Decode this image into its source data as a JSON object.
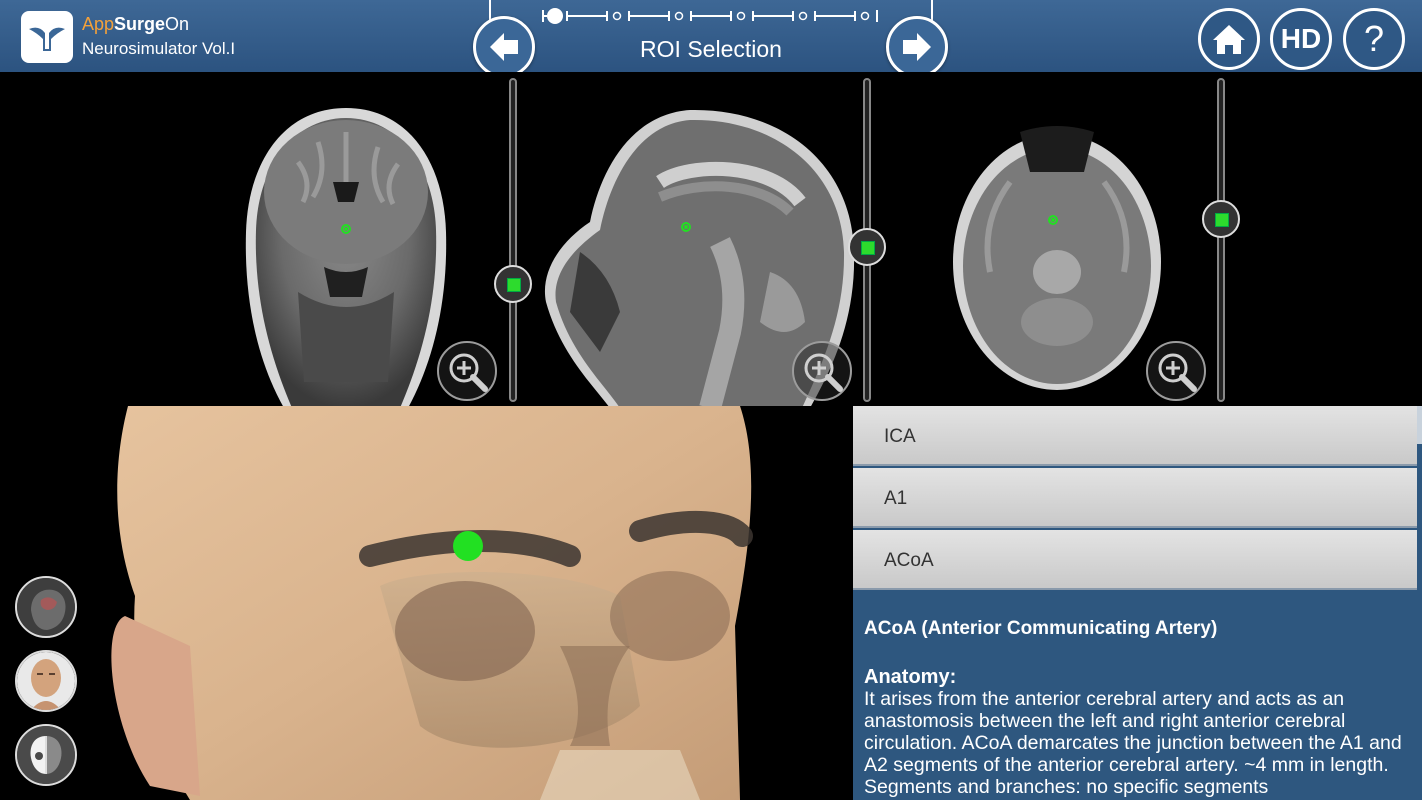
{
  "header": {
    "brand": {
      "app": "App",
      "surge": "Surge",
      "on": "On"
    },
    "subtitle": "Neurosimulator Vol.I",
    "step_title": "ROI Selection",
    "hd_label": "HD",
    "help_label": "?",
    "stepper_total": 6,
    "stepper_active": 1
  },
  "icons": {
    "app": "app-logo-icon",
    "prev": "left-arrow-icon",
    "next": "right-arrow-icon",
    "home": "home-icon",
    "zoom": "zoom-in-icon"
  },
  "mri": {
    "views": [
      "coronal",
      "sagittal",
      "axial"
    ],
    "slider_levels": [
      0.62,
      0.52,
      0.43
    ]
  },
  "list": {
    "items": [
      "ICA",
      "A1",
      "ACoA"
    ]
  },
  "info": {
    "title": "ACoA (Anterior Communicating Artery)",
    "section_heading": "Anatomy:",
    "body": "It arises from the anterior cerebral artery and acts as an anastomosis between the left and right anterior cerebral circulation. ACoA demarcates the junction between the A1 and A2 segments of the anterior cerebral artery. ~4 mm in length. Segments and branches: no specific segments"
  },
  "colors": {
    "header_bg": "#34608d",
    "panel_bg": "#2e577f",
    "marker_green": "#22e022",
    "brand_orange": "#f3a13a"
  }
}
